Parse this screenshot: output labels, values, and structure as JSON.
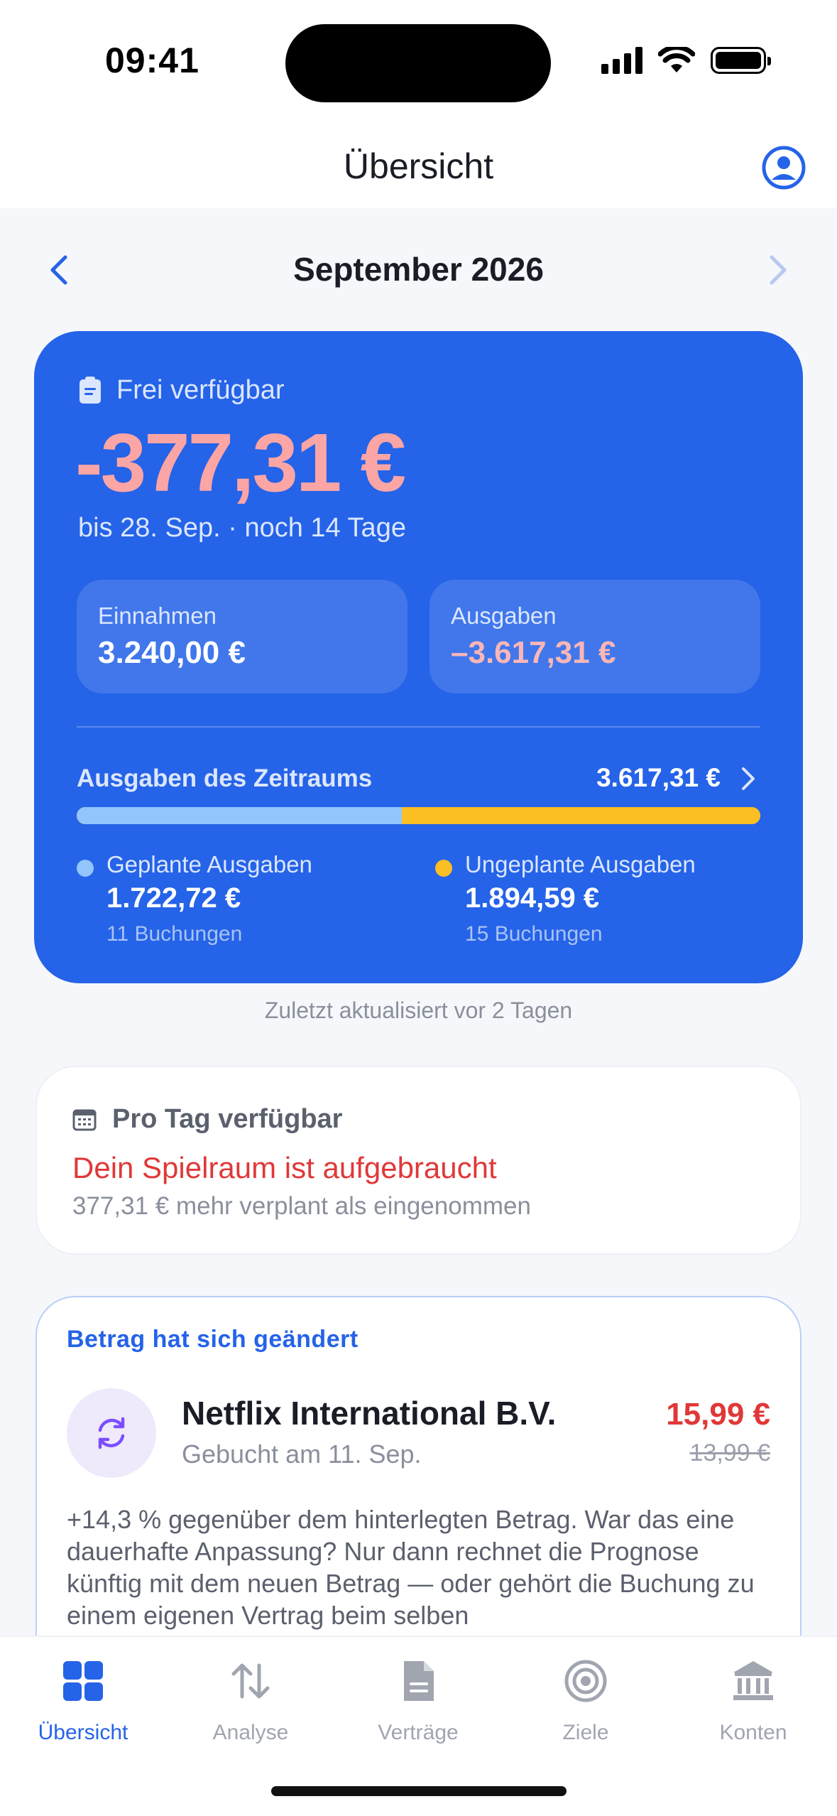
{
  "status_bar": {
    "time": "09:41"
  },
  "nav": {
    "title": "Übersicht"
  },
  "month": {
    "label": "September 2026"
  },
  "summary": {
    "available_label": "Frei verfügbar",
    "available_amount": "-377,31 €",
    "available_sub": "bis 28. Sep. · noch 14 Tage",
    "income_label": "Einnahmen",
    "income_value": "3.240,00 €",
    "expense_label": "Ausgaben",
    "expense_value": "–3.617,31 €",
    "period_label": "Ausgaben des Zeitraums",
    "period_value": "3.617,31 €",
    "planned_fraction": 0.476,
    "planned_label": "Geplante Ausgaben",
    "planned_value": "1.722,72 €",
    "planned_count": "11 Buchungen",
    "unplanned_label": "Ungeplante Ausgaben",
    "unplanned_value": "1.894,59 €",
    "unplanned_count": "15 Buchungen",
    "colors": {
      "card": "#2563e8",
      "planned": "#93c5fd",
      "unplanned": "#fbbf24",
      "negative": "#fca5a5"
    }
  },
  "updated_text": "Zuletzt aktualisiert vor 2 Tagen",
  "per_day": {
    "label": "Pro Tag verfügbar",
    "alert": "Dein Spielraum ist aufgebraucht",
    "sub": "377,31 € mehr verplant als eingenommen"
  },
  "change": {
    "tag": "Betrag hat sich geändert",
    "merchant": "Netflix International B.V.",
    "date": "Gebucht am 11. Sep.",
    "new_price": "15,99 €",
    "old_price": "13,99 €",
    "body": "+14,3 % gegenüber dem hinterlegten Betrag. War das eine dauerhafte Anpassung? Nur dann rechnet die Prognose künftig mit dem neuen Betrag — oder gehört die Buchung zu einem eigenen Vertrag beim selben"
  },
  "tabs": [
    {
      "label": "Übersicht",
      "icon": "grid-icon",
      "active": true
    },
    {
      "label": "Analyse",
      "icon": "arrows-updown-icon",
      "active": false
    },
    {
      "label": "Verträge",
      "icon": "document-icon",
      "active": false
    },
    {
      "label": "Ziele",
      "icon": "target-icon",
      "active": false
    },
    {
      "label": "Konten",
      "icon": "bank-icon",
      "active": false
    }
  ]
}
